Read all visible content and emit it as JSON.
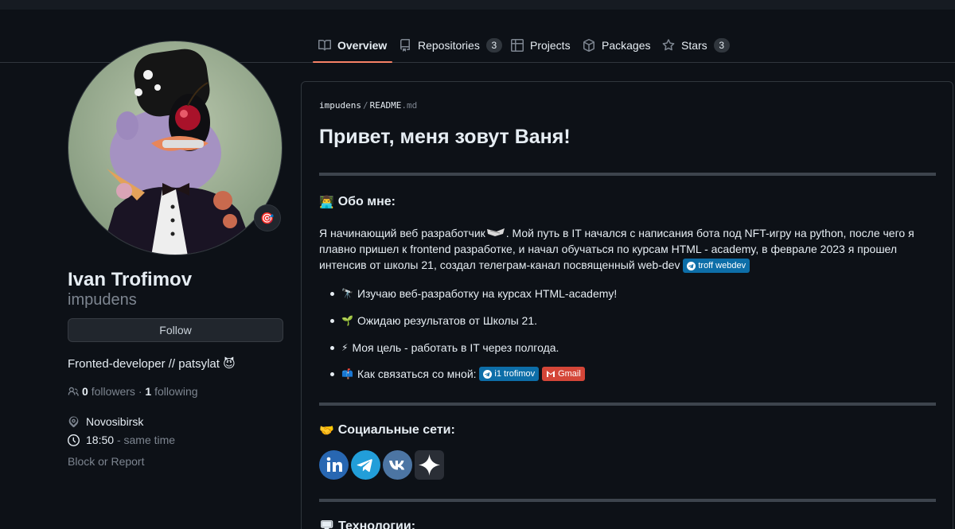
{
  "tabs": [
    {
      "label": "Overview",
      "count": null,
      "icon": "book-icon",
      "active": true
    },
    {
      "label": "Repositories",
      "count": "3",
      "icon": "repo-icon"
    },
    {
      "label": "Projects",
      "count": null,
      "icon": "table-icon"
    },
    {
      "label": "Packages",
      "count": null,
      "icon": "package-icon"
    },
    {
      "label": "Stars",
      "count": "3",
      "icon": "star-icon"
    }
  ],
  "profile": {
    "fullname": "Ivan Trofimov",
    "username": "impudens",
    "follow_label": "Follow",
    "bio": "Fronted-developer // patsylat 😈",
    "followers_count": "0",
    "followers_label": "followers",
    "following_count": "1",
    "following_label": "following",
    "location": "Novosibirsk",
    "time": "18:50",
    "time_note": "- same time",
    "block_label": "Block or Report",
    "status_emoji": "🎯"
  },
  "readme": {
    "path_user": "impudens",
    "path_sep": "/",
    "path_file": "README",
    "path_ext": ".md",
    "title": "Привет, меня зовут Ваня!",
    "about_emoji": "👨‍💻",
    "about_heading": "Обо мне:",
    "intro_a": "Я начинающий веб разработчик",
    "intro_b": ". Мой путь в IT начался с написания бота под NFT-игру на python, после чего я плавно пришел к frontend разработке, и начал обучаться по курсам HTML - academy, в феврале 2023 я прошел интенсив от школы 21, создал телеграм-канал посвященный web-dev",
    "badge_channel": "troff webdev",
    "items": [
      {
        "emoji": "🔭",
        "text": "Изучаю веб-разработку на курсах HTML-academy!"
      },
      {
        "emoji": "🌱",
        "text": "Ожидаю результатов от Школы 21."
      },
      {
        "emoji": "⚡",
        "text": "Моя цель - работать в IT через полгода."
      },
      {
        "emoji": "📫",
        "text": "Как связаться со мной:"
      }
    ],
    "badge_telegram": "i1 trofimov",
    "badge_gmail": "Gmail",
    "social_emoji": "🤝",
    "social_heading": "Социальные сети:",
    "social_icons": [
      "linkedin-icon",
      "telegram-icon",
      "vk-icon",
      "sparkle-icon"
    ],
    "tech_emoji": "🖥",
    "tech_heading": "Технологии:"
  },
  "colors": {
    "background": "#0d1117",
    "accent_tab": "#f78166",
    "linkedin": "#2867b2",
    "telegram": "#229ed9",
    "vk": "#4c75a3",
    "badge_blue": "#0d6ea8",
    "badge_red": "#d44638"
  }
}
